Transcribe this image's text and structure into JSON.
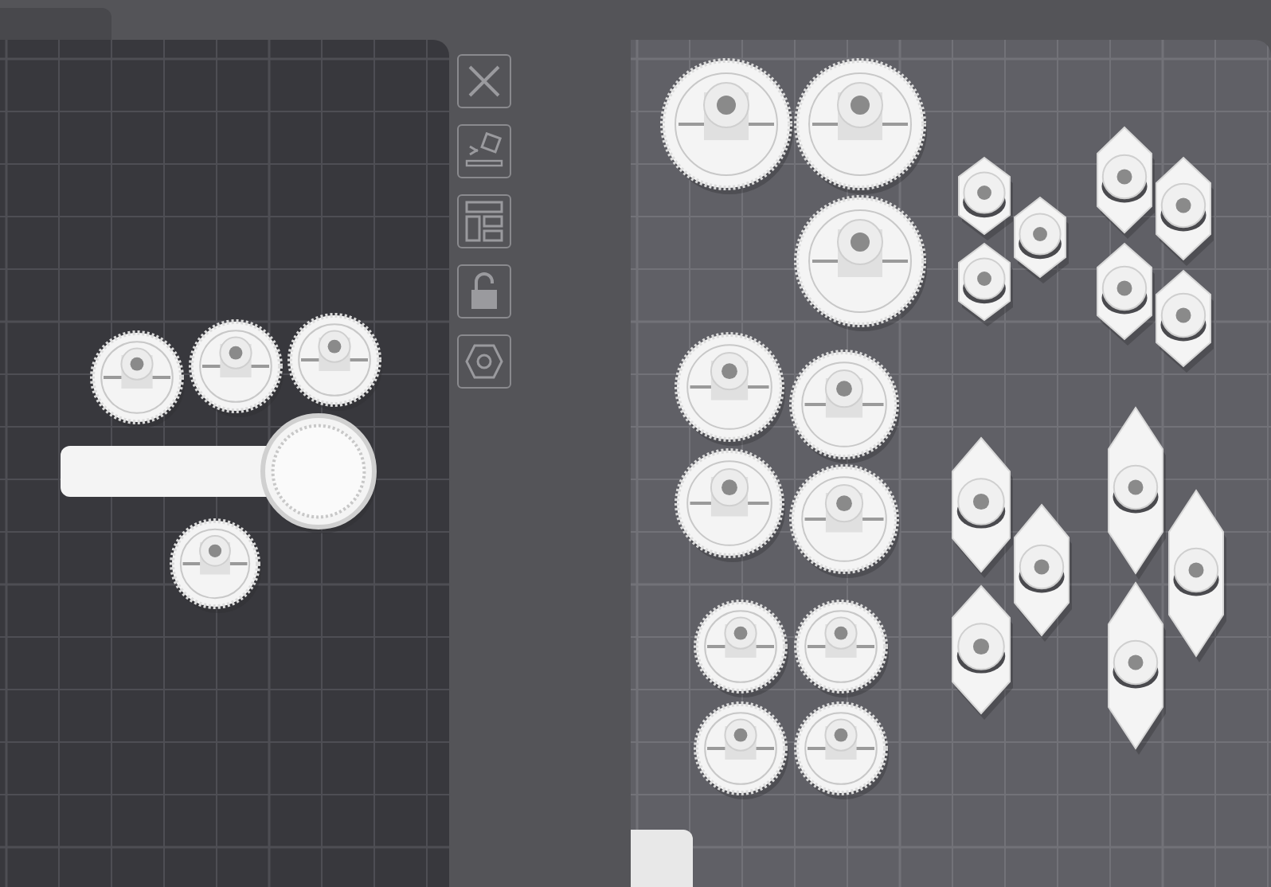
{
  "toolbar": [
    {
      "kind": "close"
    },
    {
      "kind": "arrange"
    },
    {
      "kind": "layout"
    },
    {
      "kind": "lock",
      "locked": false
    },
    {
      "kind": "settings"
    }
  ],
  "plates": [
    {
      "parts": [
        {
          "kind": "gear"
        },
        {
          "kind": "gear"
        },
        {
          "kind": "gear"
        },
        {
          "kind": "arm"
        },
        {
          "kind": "gear"
        }
      ]
    },
    {
      "parts": [
        {
          "kind": "gear"
        },
        {
          "kind": "gear"
        },
        {
          "kind": "gear"
        },
        {
          "kind": "gear"
        },
        {
          "kind": "gear"
        },
        {
          "kind": "gear"
        },
        {
          "kind": "gear"
        },
        {
          "kind": "gear"
        },
        {
          "kind": "gear"
        },
        {
          "kind": "gear"
        },
        {
          "kind": "gear"
        },
        {
          "kind": "bracket"
        },
        {
          "kind": "bracket"
        },
        {
          "kind": "bracket"
        },
        {
          "kind": "bracket"
        },
        {
          "kind": "bracket"
        },
        {
          "kind": "bracket"
        },
        {
          "kind": "bracket"
        },
        {
          "kind": "bracket"
        },
        {
          "kind": "bracket"
        },
        {
          "kind": "bracket"
        },
        {
          "kind": "bracket"
        },
        {
          "kind": "bracket"
        },
        {
          "kind": "bracket"
        }
      ]
    }
  ]
}
